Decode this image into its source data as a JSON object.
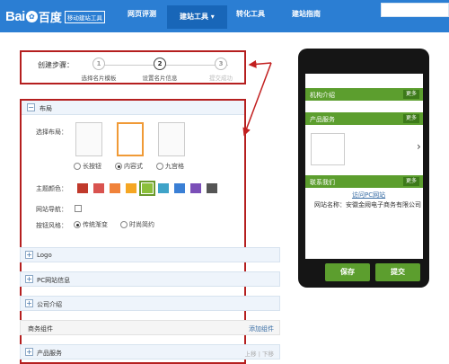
{
  "header": {
    "logo_text_bai": "Bai",
    "logo_text_du": "百度",
    "logo_tag": "移动建站工具",
    "nav": [
      {
        "label": "网页评测"
      },
      {
        "label": "建站工具 ▾"
      },
      {
        "label": "转化工具"
      },
      {
        "label": "建站指南"
      }
    ]
  },
  "steps": {
    "label": "创建步骤：",
    "items": [
      {
        "num": "1",
        "label": "选择名片模板"
      },
      {
        "num": "2",
        "label": "设置名片信息"
      },
      {
        "num": "3",
        "label": "提交成功"
      }
    ]
  },
  "layout_section": {
    "title": "布局",
    "layout_label": "选择布局：",
    "layout_options": [
      "长按钮",
      "内容式",
      "九宫格"
    ],
    "selected_layout": "内容式",
    "theme_label": "主题颜色：",
    "theme_colors": [
      "#c0392b",
      "#d9534f",
      "#f0823a",
      "#f5a623",
      "#8bbf3b",
      "#3fa3c8",
      "#3a7fd5",
      "#7b4fb8",
      "#555555"
    ],
    "selected_theme": "#8bbf3b",
    "nav_label": "网站导航：",
    "button_style_label": "按钮风格：",
    "button_styles": [
      "传统渐变",
      "时尚简约"
    ],
    "selected_button_style": "传统渐变"
  },
  "collapsed_sections": [
    {
      "title": "Logo"
    },
    {
      "title": "PC网站信息"
    },
    {
      "title": "公司介绍"
    }
  ],
  "business_components": {
    "title": "商务组件",
    "add_label": "添加组件"
  },
  "product_service": {
    "title": "产品服务",
    "up_down": "上移 | 下移"
  },
  "phone_preview": {
    "sections": [
      {
        "title": "机构介绍",
        "more": "更多"
      },
      {
        "title": "产品服务",
        "more": "更多"
      },
      {
        "title": "联系我们",
        "more": "更多"
      }
    ],
    "pc_link": "访问PC网站",
    "address": "网站名称：安徽金阙电子商务有限公司",
    "save_label": "保存",
    "submit_label": "提交"
  },
  "colors": {
    "nav_bg": "#2b7ed3",
    "accent_green": "#5c9e2e",
    "highlight_red": "#b51f1f"
  }
}
